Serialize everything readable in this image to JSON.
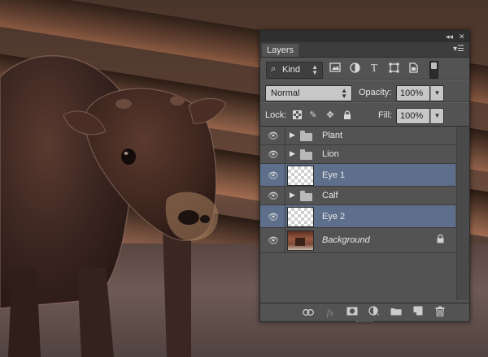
{
  "panel": {
    "tab_label": "Layers",
    "collapse_icon": "double-chevron-left-icon",
    "close_icon": "close-icon",
    "menu_icon": "panel-menu-icon"
  },
  "filter": {
    "kind_label": "Kind",
    "icons": [
      "image-filter-icon",
      "adjustment-filter-icon",
      "type-filter-icon",
      "shape-filter-icon",
      "smart-object-filter-icon"
    ]
  },
  "blend": {
    "mode": "Normal",
    "opacity_label": "Opacity:",
    "opacity_value": "100%"
  },
  "lock": {
    "label": "Lock:",
    "fill_label": "Fill:",
    "fill_value": "100%"
  },
  "layers": [
    {
      "name": "Plant",
      "type": "group",
      "selected": false
    },
    {
      "name": "Lion",
      "type": "group",
      "selected": false
    },
    {
      "name": "Eye 1",
      "type": "pixel",
      "selected": true
    },
    {
      "name": "Calf",
      "type": "group",
      "selected": false
    },
    {
      "name": "Eye 2",
      "type": "pixel",
      "selected": true
    },
    {
      "name": "Background",
      "type": "background",
      "selected": false,
      "locked": true
    }
  ],
  "bottom_bar": {
    "icons": [
      "link-layers-icon",
      "fx-icon",
      "add-mask-icon",
      "new-adjustment-layer-icon",
      "new-group-icon",
      "new-layer-icon",
      "delete-layer-icon"
    ],
    "fx_text": "fx"
  },
  "colors": {
    "panel_bg": "#535353",
    "selected_row": "#5d6f8a",
    "titlebar": "#2f2f2f"
  }
}
